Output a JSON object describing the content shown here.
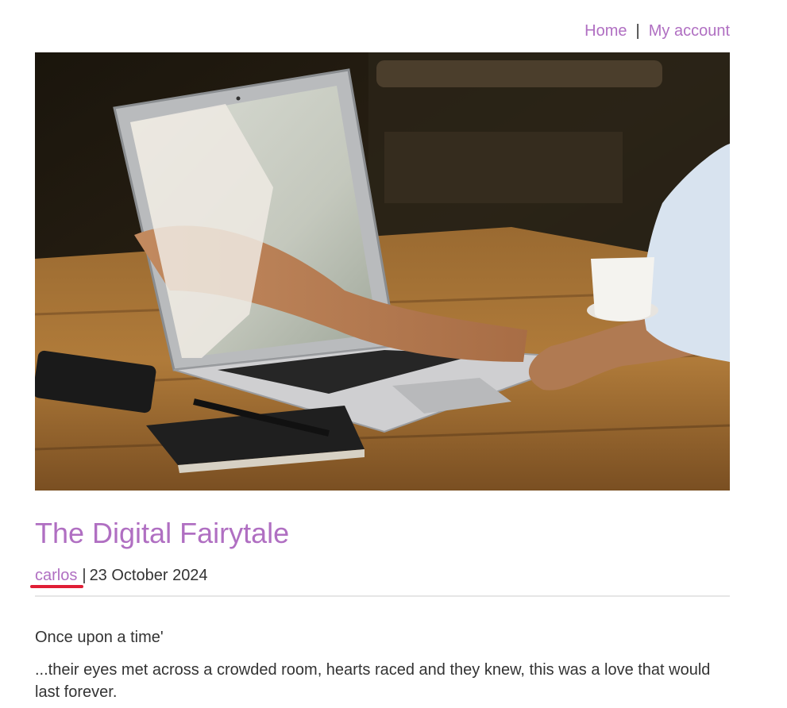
{
  "nav": {
    "home": "Home",
    "separator": "|",
    "account": "My account"
  },
  "post": {
    "title": "The Digital Fairytale",
    "author": "carlos",
    "byline_separator": "|",
    "date": "23 October 2024",
    "paragraphs": [
      "Once upon a time'",
      "...their eyes met across a crowded room, hearts raced and they knew, this was a love that would last forever."
    ]
  },
  "colors": {
    "link": "#b06fc2",
    "text": "#333333",
    "annotation": "#e01e35"
  }
}
